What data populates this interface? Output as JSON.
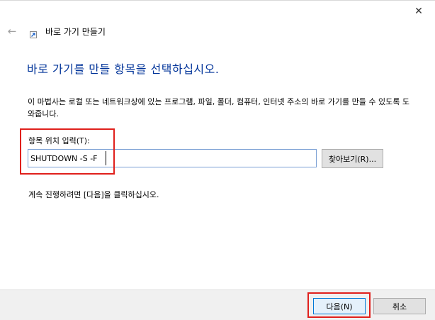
{
  "window": {
    "title": "바로 가기 만들기",
    "close_glyph": "✕",
    "back_glyph": "←"
  },
  "main": {
    "heading": "바로 가기를 만들 항목을 선택하십시오.",
    "description": "이 마법사는 로컬 또는 네트워크상에 있는 프로그램, 파일, 폴더, 컴퓨터, 인터넷 주소의 바로 가기를 만들 수 있도록 도와줍니다.",
    "location_label": "항목 위치 입력(T):",
    "location_value": "SHUTDOWN -S -F",
    "browse_label": "찾아보기(R)...",
    "continue_text": "계속 진행하려면 [다음]을 클릭하십시오."
  },
  "footer": {
    "next_label": "다음(N)",
    "cancel_label": "취소"
  },
  "colors": {
    "heading": "#003399",
    "highlight": "#e0201c",
    "default_button_border": "#0078d7"
  },
  "icons": {
    "close": "close-icon",
    "back": "back-arrow-icon",
    "app": "shortcut-icon"
  }
}
